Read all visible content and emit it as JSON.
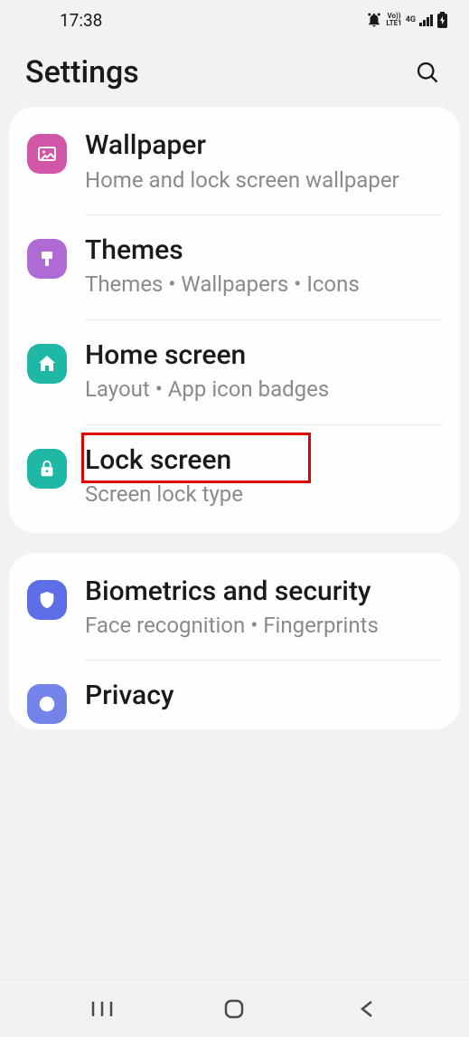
{
  "status": {
    "time": "17:38",
    "network_label": "Vo))",
    "lte_label": "LTE1",
    "signal_label": "4G"
  },
  "header": {
    "title": "Settings"
  },
  "groups": [
    {
      "items": [
        {
          "title": "Wallpaper",
          "sub": "Home and lock screen wallpaper",
          "icon": "image",
          "color": "#d256a7"
        },
        {
          "title": "Themes",
          "sub": "Themes  •  Wallpapers  •  Icons",
          "icon": "brush",
          "color": "#b06ad4"
        },
        {
          "title": "Home screen",
          "sub": "Layout  •  App icon badges",
          "icon": "home",
          "color": "#1fb8a6"
        },
        {
          "title": "Lock screen",
          "sub": "Screen lock type",
          "icon": "lock",
          "color": "#1fb8a6",
          "highlighted": true
        }
      ]
    },
    {
      "items": [
        {
          "title": "Biometrics and security",
          "sub": "Face recognition  •  Fingerprints",
          "icon": "shield",
          "color": "#5d6ee6"
        },
        {
          "title": "Privacy",
          "sub": "",
          "icon": "privacy",
          "color": "#5d6ee6"
        }
      ]
    }
  ]
}
